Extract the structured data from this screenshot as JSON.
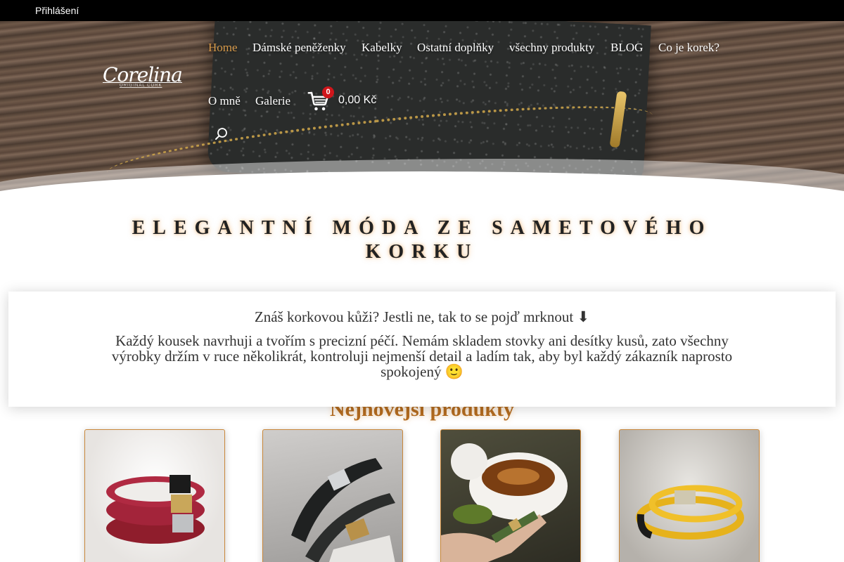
{
  "topbar": {
    "login_label": "Přihlášení"
  },
  "logo": {
    "name": "Corelina",
    "tagline": "ORIGINAL CORK"
  },
  "nav": {
    "items": [
      "Home",
      "Dámské peněženky",
      "Kabelky",
      "Ostatní doplňky",
      "všechny produkty",
      "BLOG",
      "Co je korek?",
      "O mně",
      "Galerie"
    ],
    "active_item": "Home",
    "cart_count": "0",
    "cart_total": "0,00 Kč"
  },
  "hero": {
    "headline": "ELEGANTNÍ MÓDA ZE SAMETOVÉHO KORKU"
  },
  "info": {
    "question": "Znáš korkovou kůži? Jestli ne, tak to se pojď mrknout ⬇",
    "text": "Každý kousek navrhuji a tvořím s precizní péčí. Nemám skladem stovky ani desítky kusů, zato všechny výrobky držím v ruce několikrát, kontroluji nejmenší detail a ladím tak, aby byl každý zákazník naprosto spokojený 🙂"
  },
  "products": {
    "title": "Nejnovější produkty",
    "items": [
      {
        "name": "red-cork-bracelets"
      },
      {
        "name": "black-cork-bracelets"
      },
      {
        "name": "green-cork-bracelet-coffee"
      },
      {
        "name": "yellow-cork-bracelet"
      }
    ]
  },
  "colors": {
    "accent": "#d79a4a",
    "title": "#b36b1f",
    "badge": "#d0161b",
    "topbar": "#000000"
  }
}
